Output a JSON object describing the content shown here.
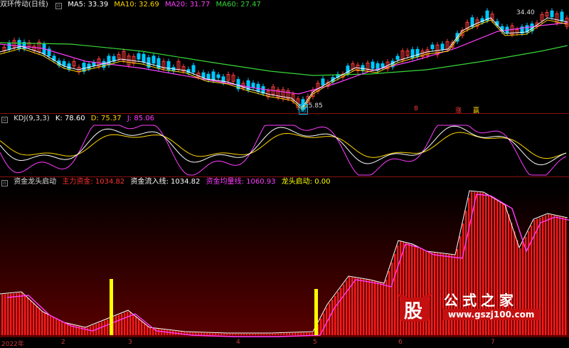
{
  "pane1": {
    "title": "双环传动(日线)",
    "ma": [
      {
        "label": "MA5: 33.39",
        "color": "#ffffff"
      },
      {
        "label": "MA10: 32.69",
        "color": "#ffd500"
      },
      {
        "label": "MA20: 31.77",
        "color": "#ff3cff"
      },
      {
        "label": "MA60: 27.47",
        "color": "#38d838"
      }
    ],
    "high_label": "34.40",
    "low_label": "15.85",
    "marker_cai": "财",
    "marker_8": "8",
    "marker_zhang": "涨",
    "marker_ying": "赢"
  },
  "pane2": {
    "title": "KDJ(9,3,3)",
    "k": "K: 78.60",
    "d": "D: 75.37",
    "j": "J: 85.06",
    "colors": {
      "k": "#ffffff",
      "d": "#ffd500",
      "j": "#ff3cff"
    }
  },
  "pane3": {
    "title": "资金龙头启动",
    "items": [
      {
        "label": "主力资金: 1034.82",
        "color": "#ff3030"
      },
      {
        "label": "资金流入线: 1034.82",
        "color": "#ffffff"
      },
      {
        "label": "资金均量线: 1060.93",
        "color": "#ff3cff"
      },
      {
        "label": "龙头启动: 0.00",
        "color": "#ffff00"
      }
    ]
  },
  "xaxis": {
    "labels": [
      "2022年",
      "2",
      "3",
      "4",
      "5",
      "6",
      "7"
    ]
  },
  "watermark": {
    "logo_text": "股",
    "name": "公式之家",
    "url": "www.gszj100.com"
  },
  "colors": {
    "up": "#ff3c3c",
    "down": "#00c8ff",
    "bars": "#ff1a1a",
    "signal": "#ffff00"
  }
}
